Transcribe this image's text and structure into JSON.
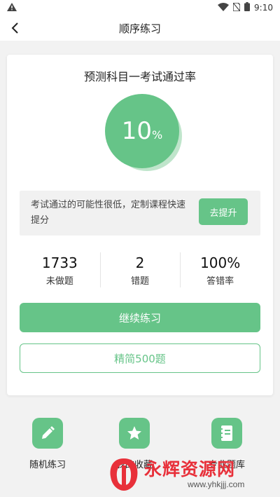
{
  "status_bar": {
    "time": "9:10",
    "icons": [
      "warning-icon",
      "wifi-icon",
      "no-sim-icon",
      "battery-icon"
    ]
  },
  "header": {
    "title": "顺序练习"
  },
  "card": {
    "title": "预测科目一考试通过率",
    "pass_rate": {
      "value": "10",
      "unit": "%"
    },
    "tip": {
      "text": "考试通过的可能性很低，定制课程快速提分",
      "button_label": "去提升"
    },
    "stats": [
      {
        "value": "1733",
        "label": "未做题"
      },
      {
        "value": "2",
        "label": "错题"
      },
      {
        "value": "100%",
        "label": "答错率"
      }
    ],
    "primary_button": "继续练习",
    "secondary_button": "精简500题"
  },
  "features": [
    {
      "label": "随机练习",
      "icon": "pencil-icon"
    },
    {
      "label": "我的收藏",
      "icon": "star-icon"
    },
    {
      "label": "专业题库",
      "icon": "notebook-icon"
    }
  ],
  "watermark": {
    "text": "永辉资源网",
    "url": "www.yhkjjj.com"
  },
  "colors": {
    "accent": "#66c488",
    "accent_light": "#a9dcb9",
    "watermark": "#e8303a"
  }
}
